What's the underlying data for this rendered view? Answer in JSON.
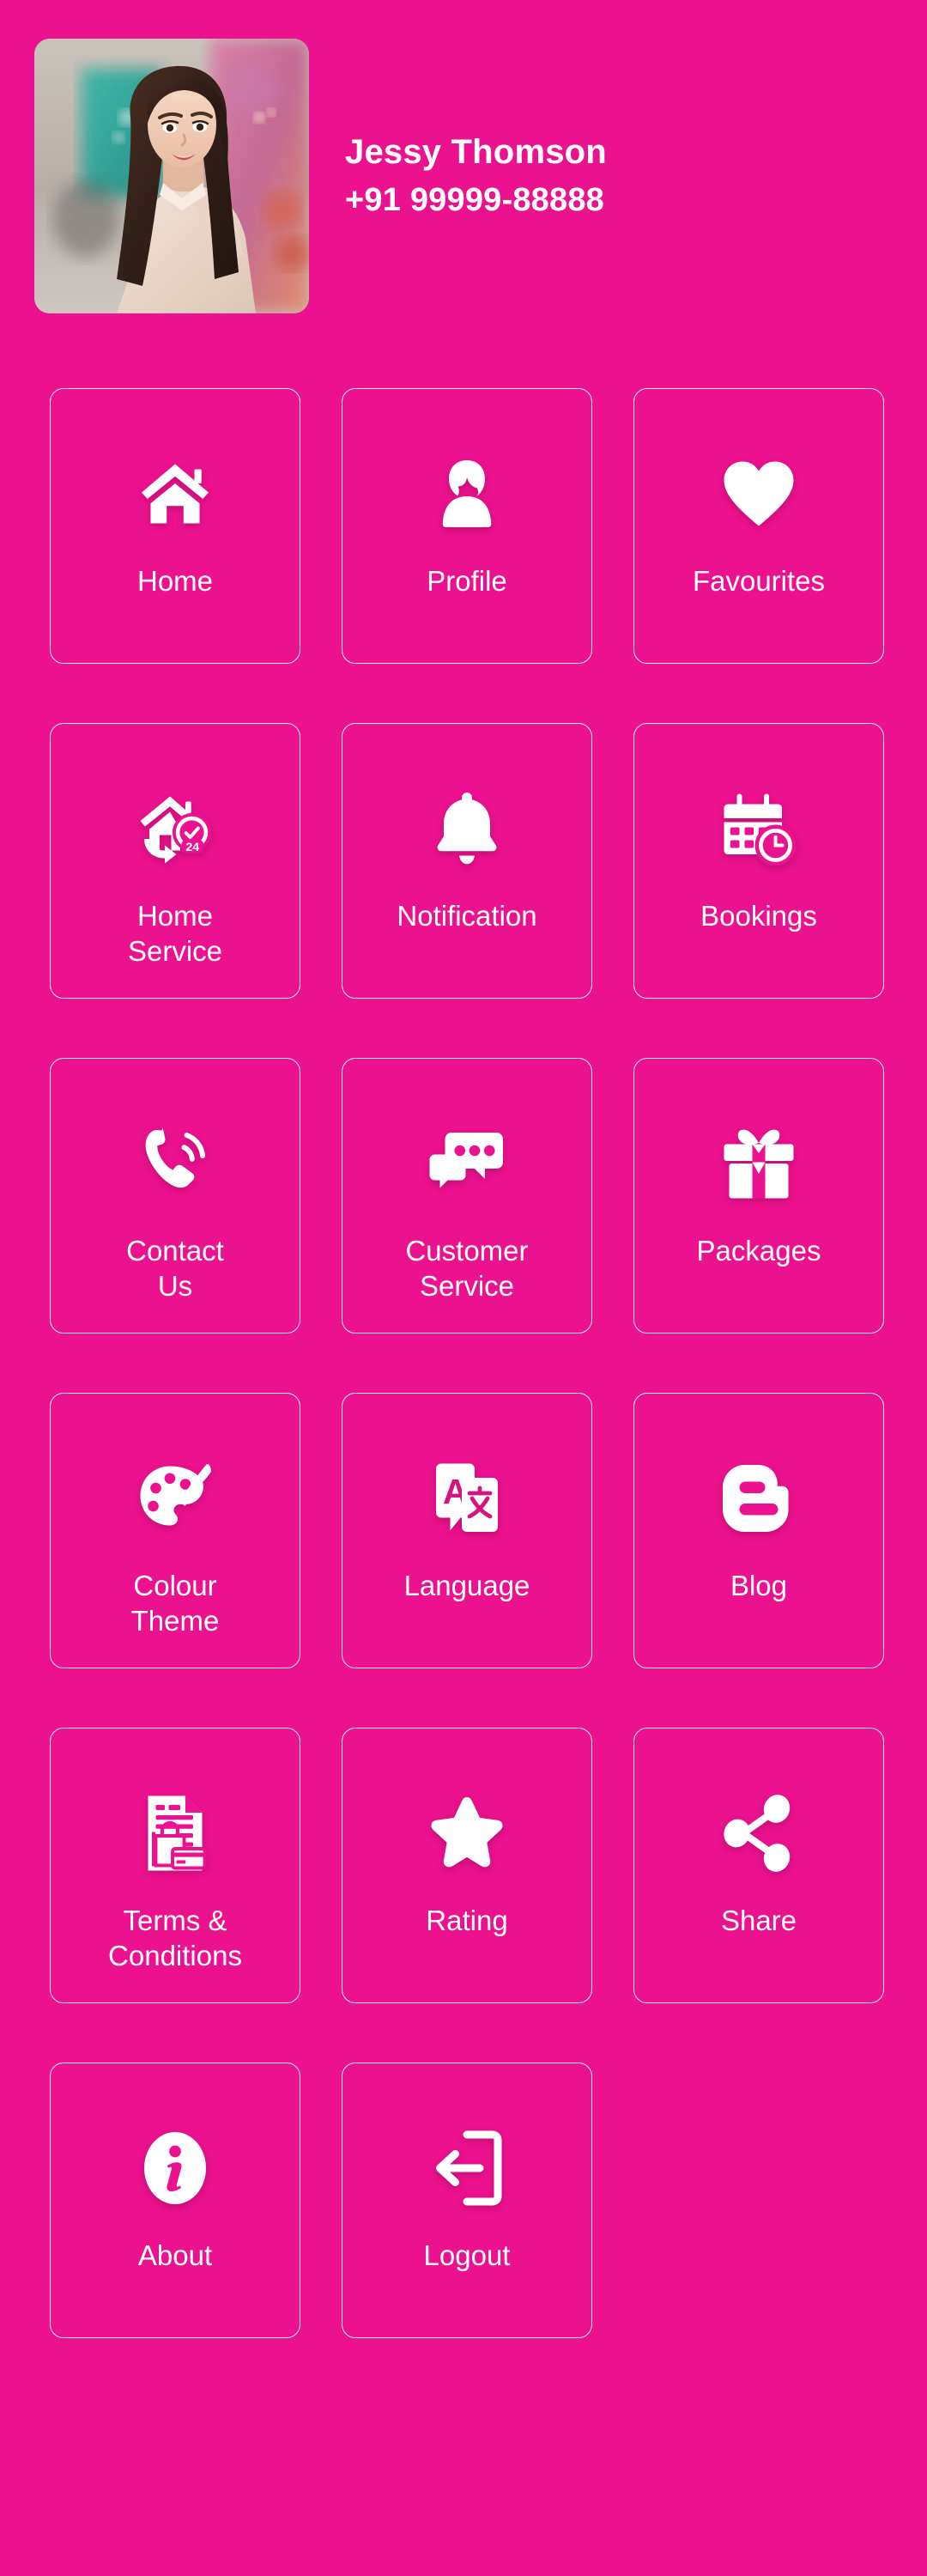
{
  "theme": {
    "background": "#EC118E",
    "foreground": "#FFFFFF",
    "tile_border": "#FFFFFF"
  },
  "profile": {
    "name": "Jessy Thomson",
    "phone": "+91 99999-88888",
    "avatar_alt": "profile-photo"
  },
  "menu": {
    "items": [
      {
        "label": "Home",
        "icon": "home-icon"
      },
      {
        "label": "Profile",
        "icon": "profile-icon"
      },
      {
        "label": "Favourites",
        "icon": "heart-icon"
      },
      {
        "label": "Home\nService",
        "icon": "home-service-icon"
      },
      {
        "label": "Notification",
        "icon": "bell-icon"
      },
      {
        "label": "Bookings",
        "icon": "calendar-clock-icon"
      },
      {
        "label": "Contact\nUs",
        "icon": "phone-call-icon"
      },
      {
        "label": "Customer\nService",
        "icon": "chat-bubbles-icon"
      },
      {
        "label": "Packages",
        "icon": "gift-icon"
      },
      {
        "label": "Colour\nTheme",
        "icon": "palette-icon"
      },
      {
        "label": "Language",
        "icon": "translate-icon"
      },
      {
        "label": "Blog",
        "icon": "blogger-icon"
      },
      {
        "label": "Terms &\nConditions",
        "icon": "document-icon"
      },
      {
        "label": "Rating",
        "icon": "star-icon"
      },
      {
        "label": "Share",
        "icon": "share-icon"
      },
      {
        "label": "About",
        "icon": "info-icon"
      },
      {
        "label": "Logout",
        "icon": "logout-icon"
      }
    ]
  }
}
